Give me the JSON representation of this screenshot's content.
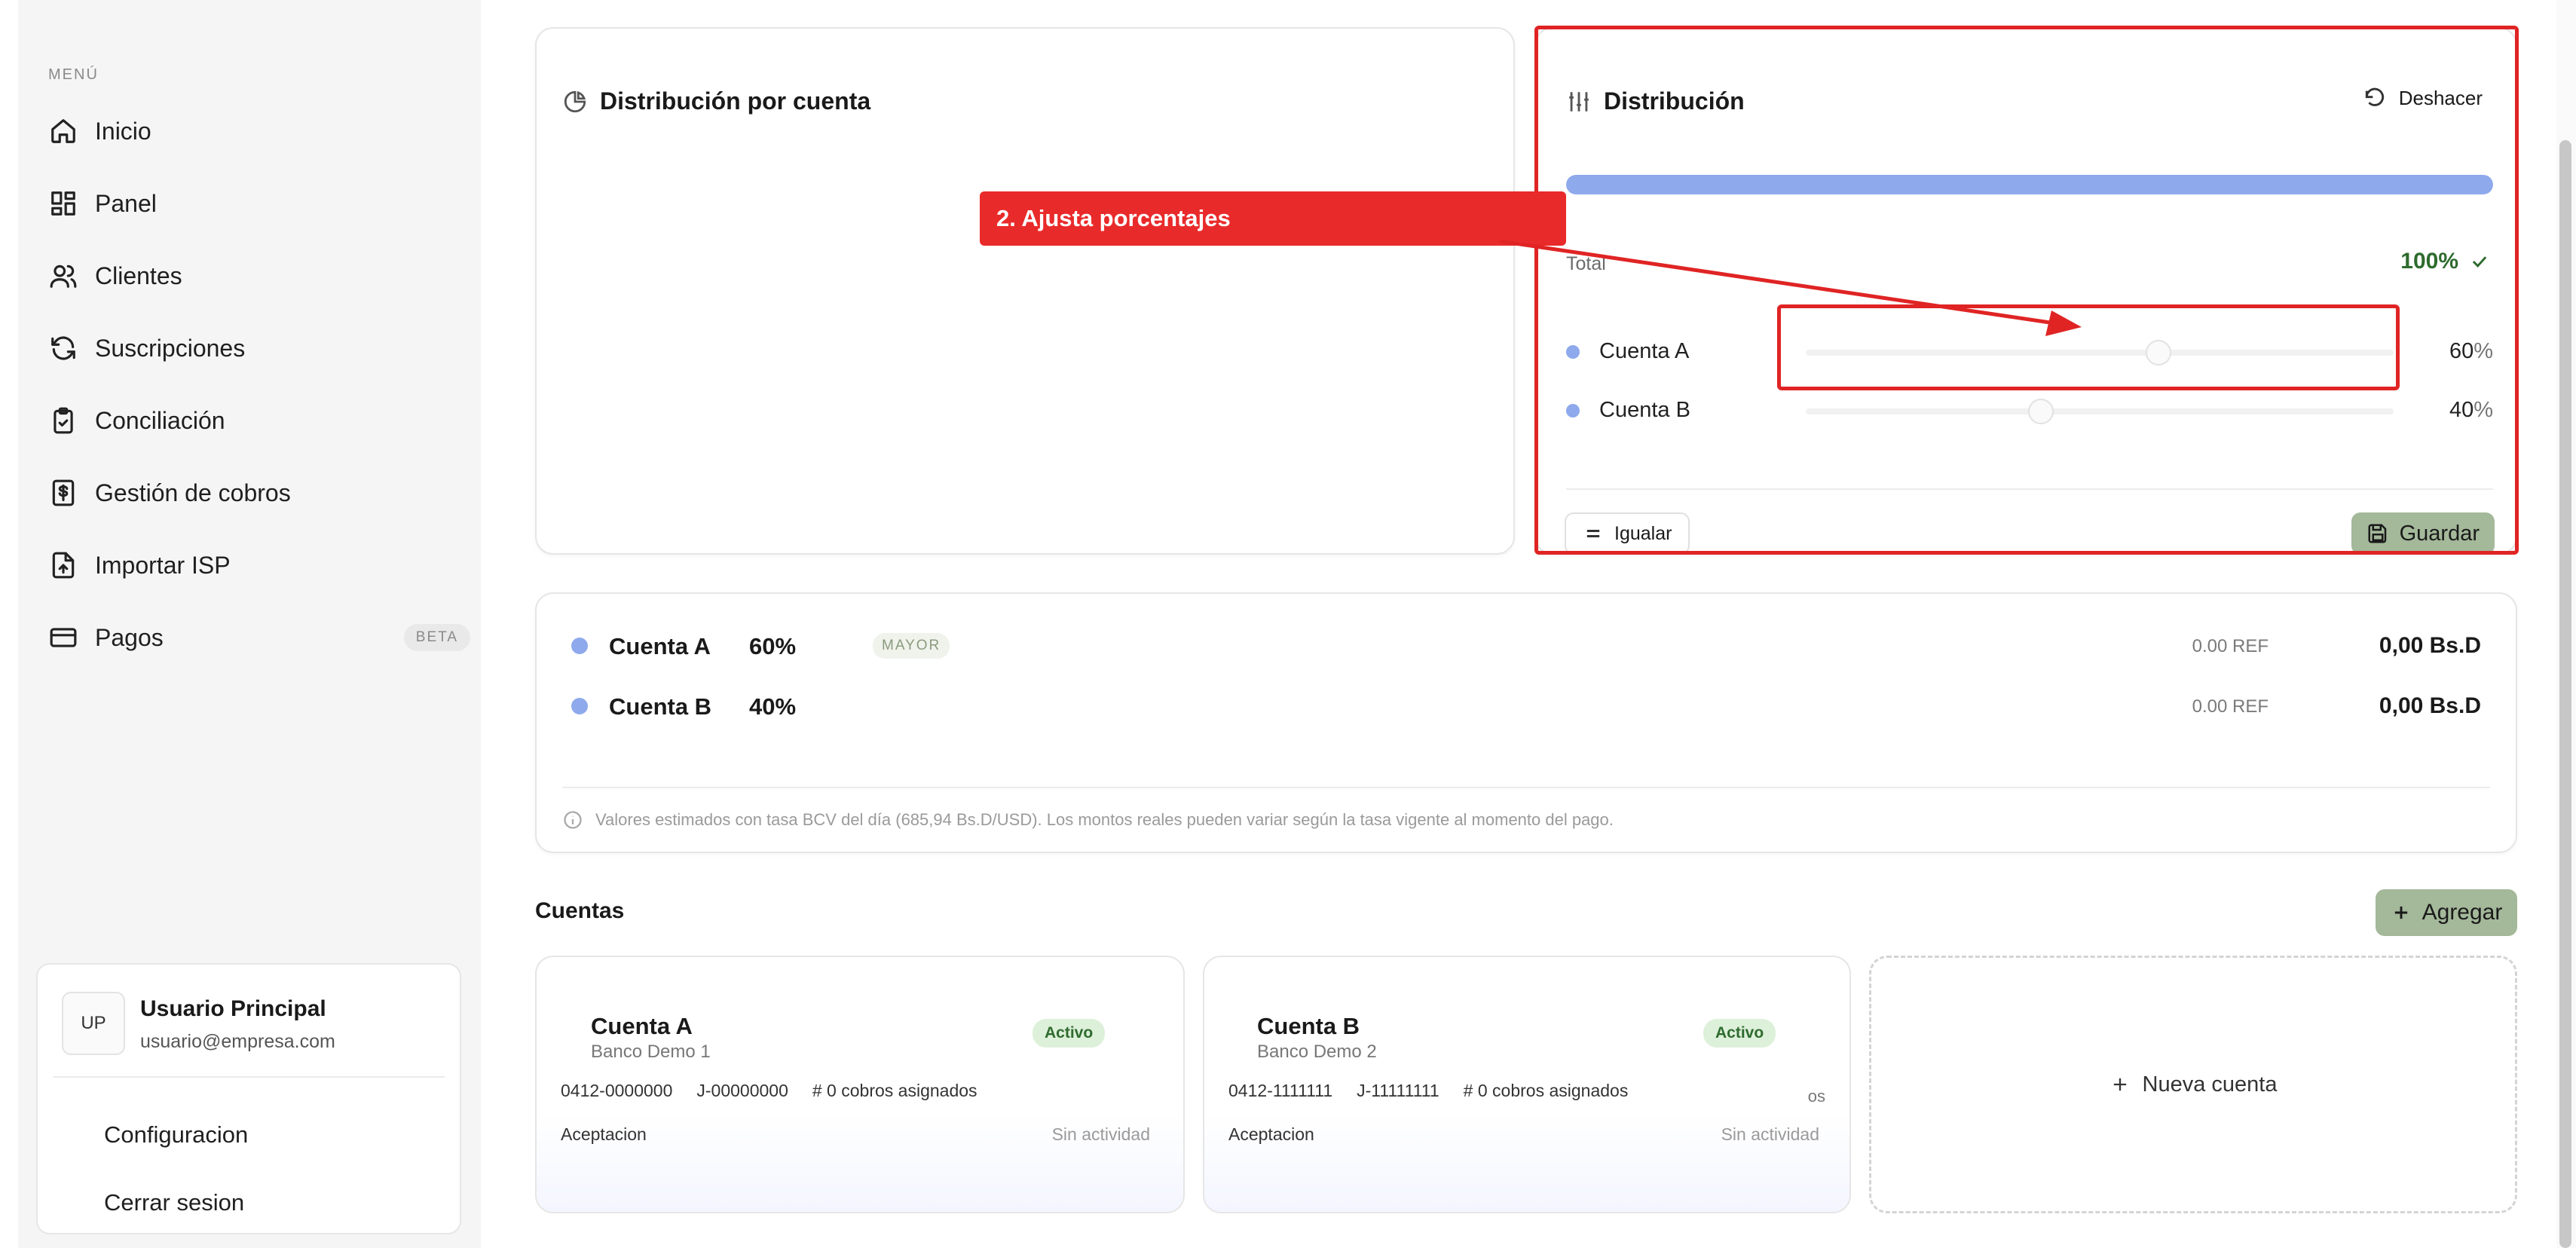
{
  "sidebar": {
    "menu_heading": "MENÚ",
    "items": [
      {
        "label": "Inicio",
        "icon": "home-icon"
      },
      {
        "label": "Panel",
        "icon": "dashboard-icon"
      },
      {
        "label": "Clientes",
        "icon": "users-icon"
      },
      {
        "label": "Suscripciones",
        "icon": "refresh-icon"
      },
      {
        "label": "Conciliación",
        "icon": "clipboard-check-icon"
      },
      {
        "label": "Gestión de cobros",
        "icon": "dollar-file-icon"
      },
      {
        "label": "Importar ISP",
        "icon": "file-upload-icon"
      },
      {
        "label": "Pagos",
        "icon": "credit-card-icon",
        "badge": "BETA"
      }
    ],
    "user": {
      "initials": "UP",
      "name": "Usuario Principal",
      "email": "usuario@empresa.com",
      "menu": [
        "Configuracion",
        "Cerrar sesion"
      ]
    }
  },
  "chart_panel": {
    "title": "Distribución por cuenta",
    "icon": "pie-chart-icon"
  },
  "distribution": {
    "title": "Distribución",
    "icon": "sliders-icon",
    "undo_label": "Deshacer",
    "total_label": "Total",
    "total_value": "100%",
    "progress": 1.0,
    "rows": [
      {
        "name": "Cuenta A",
        "value": "60",
        "fraction": 0.6
      },
      {
        "name": "Cuenta B",
        "value": "40",
        "fraction": 0.4
      }
    ],
    "pct_sign": "%",
    "equalize_label": "Igualar",
    "save_label": "Guardar"
  },
  "annotation": {
    "callout": "2. Ajusta porcentajes"
  },
  "summary": {
    "rows": [
      {
        "name": "Cuenta A",
        "pct": "60%",
        "badge": "MAYOR",
        "ref": "0.00 REF",
        "bs": "0,00 Bs.D"
      },
      {
        "name": "Cuenta B",
        "pct": "40%",
        "ref": "0.00 REF",
        "bs": "0,00 Bs.D"
      }
    ],
    "note": "Valores estimados con tasa BCV del día (685,94 Bs.D/USD). Los montos reales pueden variar según la tasa vigente al momento del pago."
  },
  "accounts_section": {
    "title": "Cuentas",
    "add_label": "Agregar",
    "new_account_label": "Nueva cuenta",
    "cards": [
      {
        "name": "Cuenta A",
        "bank": "Banco Demo 1",
        "status": "Activo",
        "phone": "0412-0000000",
        "rif": "J-00000000",
        "cobros": "# 0 cobros asignados",
        "accept": "Aceptacion",
        "activity": "Sin actividad"
      },
      {
        "name": "Cuenta B",
        "bank": "Banco Demo 2",
        "status": "Activo",
        "phone": "0412-1111111",
        "rif": "J-11111111",
        "cobros": "# 0 cobros asignados",
        "accept": "Aceptacion",
        "activity": "Sin actividad",
        "ghost_text": "os"
      }
    ]
  },
  "colors": {
    "accent_green": "#a4b89a",
    "series_blue": "#8ea9ec",
    "annotation_red": "#e92a2a",
    "success_green": "#2e6b2e"
  }
}
